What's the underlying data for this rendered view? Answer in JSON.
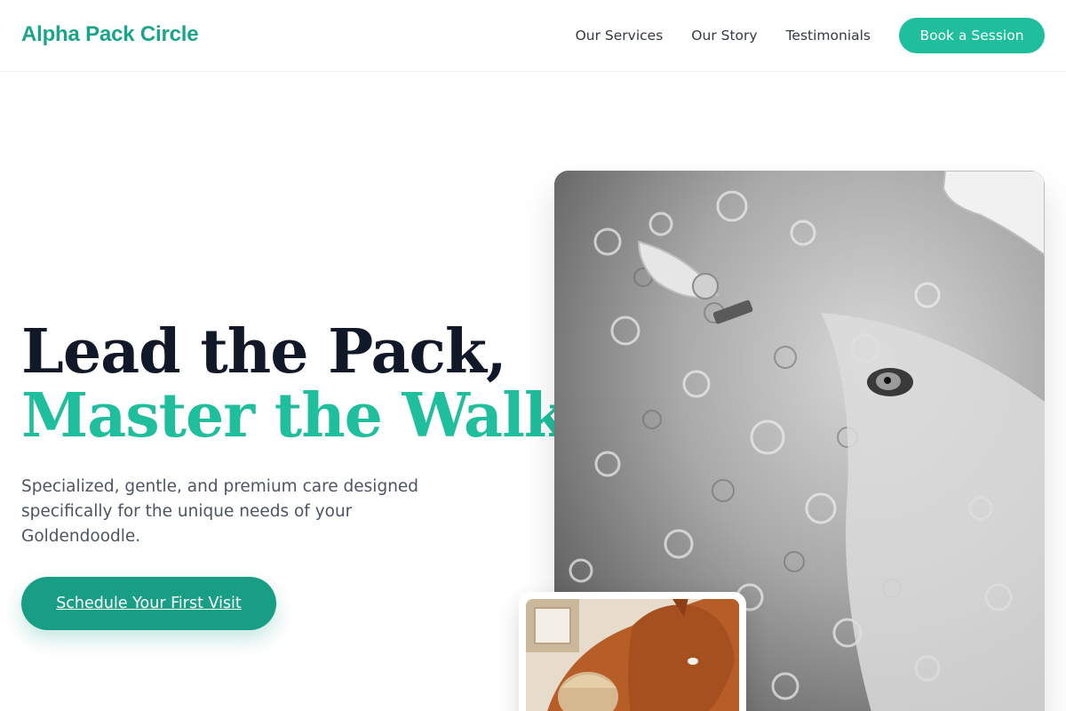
{
  "header": {
    "logo": "Alpha Pack Circle",
    "nav": {
      "services": "Our Services",
      "story": "Our Story",
      "testimonials": "Testimonials",
      "cta": "Book a Session"
    }
  },
  "hero": {
    "headline_line1": "Lead the Pack,",
    "headline_line2": "Master the Walk.",
    "subtext": "Specialized, gentle, and premium care designed specifically for the unique needs of your Goldendoodle.",
    "primary_cta": "Schedule Your First Visit",
    "main_image_alt": "Close-up black and white photo of a curly-fleeced sheep",
    "inset_image_alt": "Person with a chestnut horse"
  },
  "colors": {
    "accent": "#1fbe9c",
    "accent_dark": "#179e84",
    "heading": "#111827",
    "body_text": "#4b5563"
  }
}
